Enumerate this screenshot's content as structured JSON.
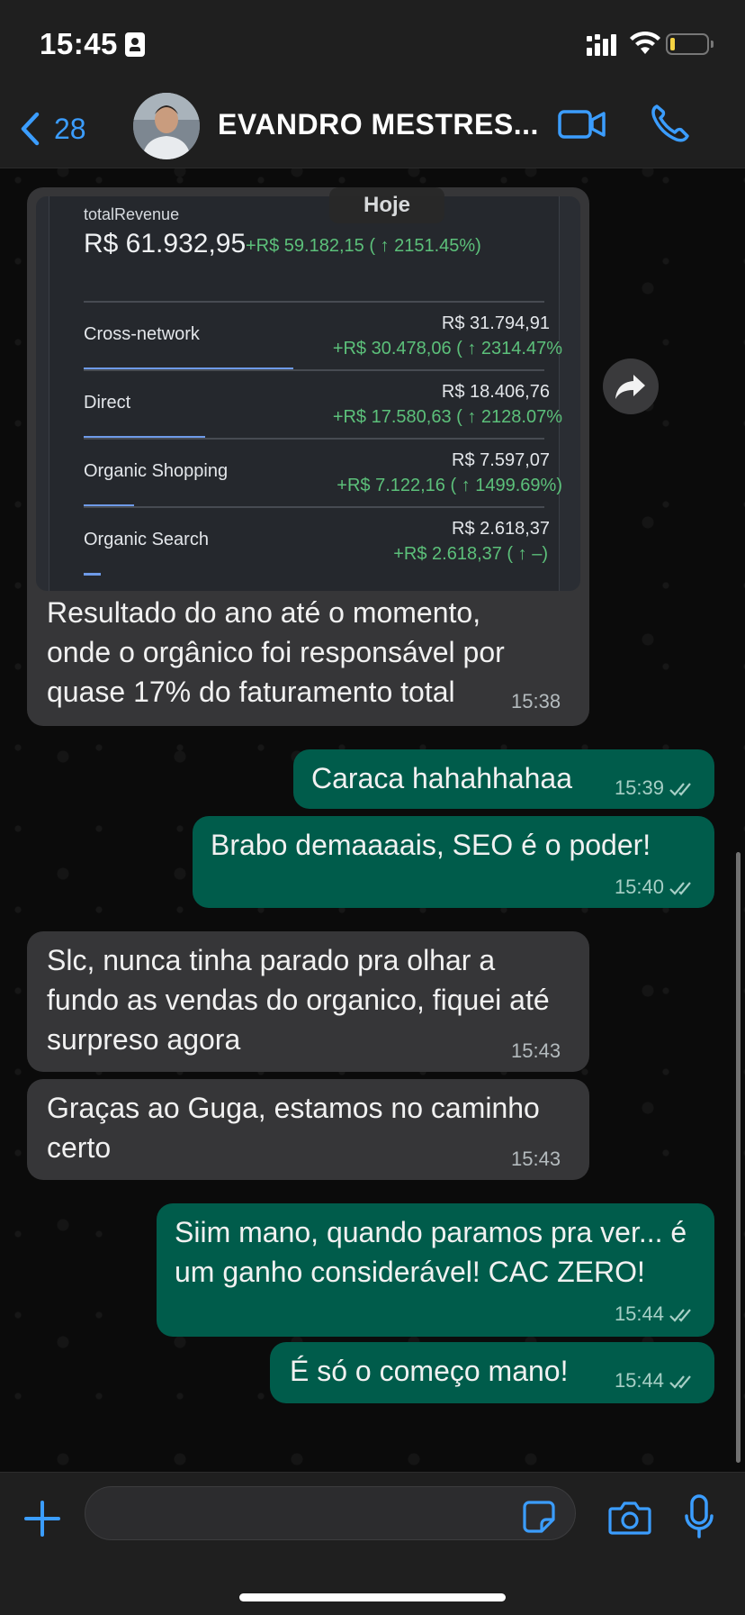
{
  "status_bar": {
    "time": "15:45",
    "battery_color": "#f5d342"
  },
  "header": {
    "back_count": "28",
    "contact_name": "EVANDRO MESTRES...",
    "accent": "#3b9dff"
  },
  "date_chip": "Hoje",
  "image_message": {
    "total_revenue_label": "totalRevenue",
    "total_revenue_value": "R$ 61.932,95",
    "total_revenue_delta": "+R$ 59.182,15 ( ↑ 2151.45%)",
    "channels": [
      {
        "name": "Cross-network",
        "value": "R$ 31.794,91",
        "delta": "+R$ 30.478,06 ( ↑ 2314.47%",
        "share": 0.513
      },
      {
        "name": "Direct",
        "value": "R$ 18.406,76",
        "delta": "+R$ 17.580,63 ( ↑ 2128.07%",
        "share": 0.297
      },
      {
        "name": "Organic Shopping",
        "value": "R$ 7.597,07",
        "delta": "+R$ 7.122,16 ( ↑ 1499.69%)",
        "share": 0.123
      },
      {
        "name": "Organic Search",
        "value": "R$ 2.618,37",
        "delta": "+R$ 2.618,37 ( ↑ –)",
        "share": 0.042
      }
    ],
    "caption": "Resultado do ano até o momento, onde o orgânico foi responsável por quase 17% do faturamento total",
    "time": "15:38"
  },
  "messages": [
    {
      "direction": "out",
      "text": "Caraca hahahhahaa",
      "time": "15:39"
    },
    {
      "direction": "out",
      "text": "Brabo demaaaais, SEO é o poder!",
      "time": "15:40"
    },
    {
      "direction": "in",
      "text": "Slc, nunca tinha parado pra olhar a fundo as vendas do organico, fiquei até surpreso agora",
      "time": "15:43"
    },
    {
      "direction": "in",
      "text": "Graças ao Guga, estamos no caminho certo",
      "time": "15:43"
    },
    {
      "direction": "out",
      "text": "Siim mano, quando paramos pra ver... é um ganho considerável! CAC ZERO!",
      "time": "15:44"
    },
    {
      "direction": "out",
      "text": "É só o começo mano!",
      "time": "15:44"
    }
  ],
  "colors": {
    "incoming_bubble": "#363638",
    "outgoing_bubble": "#005c4b",
    "positive": "#5cc07a"
  }
}
